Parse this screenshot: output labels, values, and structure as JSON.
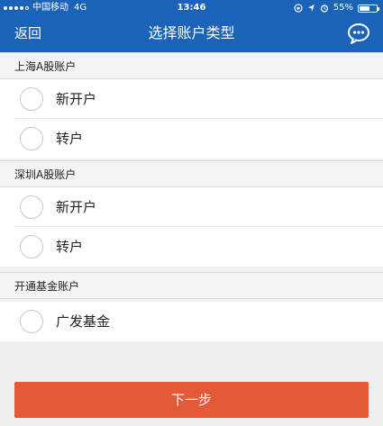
{
  "status_bar": {
    "carrier": "中国移动",
    "network": "4G",
    "time": "13:46",
    "battery": "55%",
    "battery_level": 0.55
  },
  "nav": {
    "back_label": "返回",
    "title": "选择账户类型",
    "chat_icon": "chat-bubble-icon"
  },
  "sections": [
    {
      "title": "上海A股账户",
      "options": [
        "新开户",
        "转户"
      ]
    },
    {
      "title": "深圳A股账户",
      "options": [
        "新开户",
        "转户"
      ]
    },
    {
      "title": "开通基金账户",
      "options": [
        "广发基金"
      ]
    }
  ],
  "next_button": {
    "label": "下一步"
  },
  "colors": {
    "nav_bg": "#1a63b8",
    "button_bg": "#e25a36",
    "page_bg": "#efeff4"
  }
}
